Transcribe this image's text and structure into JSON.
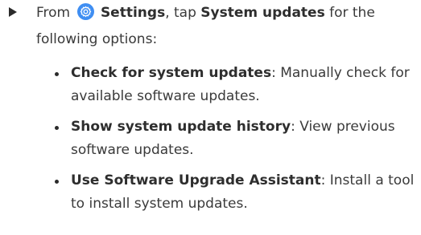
{
  "step": {
    "prefix": "From",
    "settings_icon": "settings-gear-icon",
    "settings_label": "Settings",
    "middle": ", tap",
    "target_label": "System updates",
    "suffix_line1": "for the",
    "line2": "following options:"
  },
  "options": [
    {
      "title": "Check for system updates",
      "desc_line1": ": Manually check for",
      "desc_line2": "available software updates."
    },
    {
      "title": "Show system update history",
      "desc_line1": ": View previous",
      "desc_line2": "software updates."
    },
    {
      "title": "Use Software Upgrade Assistant",
      "desc_line1": ": Install a tool",
      "desc_line2": "to install system updates."
    }
  ],
  "colors": {
    "icon_bg": "#3f8ef2",
    "text": "#3a3a3a",
    "bullet": "#2b2b2b"
  }
}
